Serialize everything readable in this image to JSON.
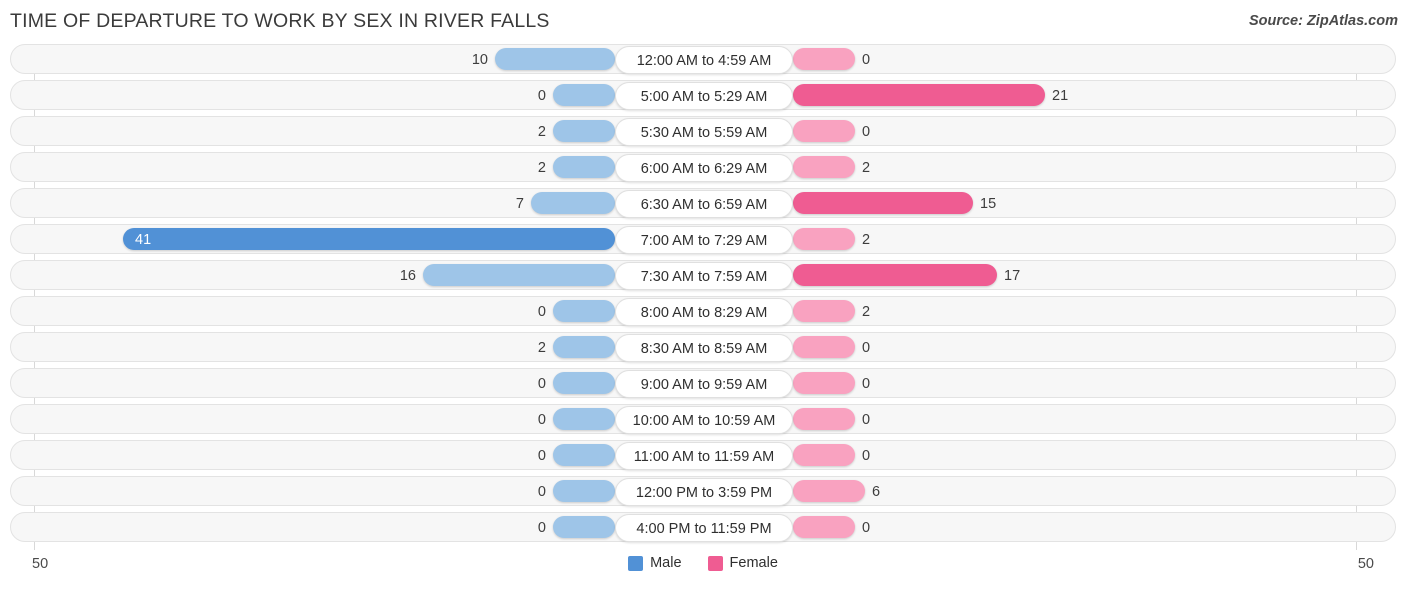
{
  "header": {
    "title": "TIME OF DEPARTURE TO WORK BY SEX IN RIVER FALLS",
    "source": "Source: ZipAtlas.com"
  },
  "legend": {
    "male_label": "Male",
    "female_label": "Female",
    "male_color": "#5191d6",
    "female_color": "#ef5c92"
  },
  "axis": {
    "left_label": "50",
    "right_label": "50"
  },
  "chart_data": {
    "type": "bar",
    "title": "TIME OF DEPARTURE TO WORK BY SEX IN RIVER FALLS",
    "subtitle": "",
    "xlabel": "",
    "ylabel": "",
    "orientation": "horizontal-diverging",
    "axis_max": 50,
    "xlim": [
      50,
      50
    ],
    "grid": false,
    "legend_position": "bottom-center",
    "categories": [
      "12:00 AM to 4:59 AM",
      "5:00 AM to 5:29 AM",
      "5:30 AM to 5:59 AM",
      "6:00 AM to 6:29 AM",
      "6:30 AM to 6:59 AM",
      "7:00 AM to 7:29 AM",
      "7:30 AM to 7:59 AM",
      "8:00 AM to 8:29 AM",
      "8:30 AM to 8:59 AM",
      "9:00 AM to 9:59 AM",
      "10:00 AM to 10:59 AM",
      "11:00 AM to 11:59 AM",
      "12:00 PM to 3:59 PM",
      "4:00 PM to 11:59 PM"
    ],
    "series": [
      {
        "name": "Male",
        "color": "#5191d6",
        "values": [
          10,
          0,
          2,
          2,
          7,
          41,
          16,
          0,
          2,
          0,
          0,
          0,
          0,
          0
        ]
      },
      {
        "name": "Female",
        "color": "#ef5c92",
        "values": [
          0,
          21,
          0,
          2,
          15,
          2,
          17,
          2,
          0,
          0,
          0,
          0,
          6,
          0
        ]
      }
    ]
  }
}
